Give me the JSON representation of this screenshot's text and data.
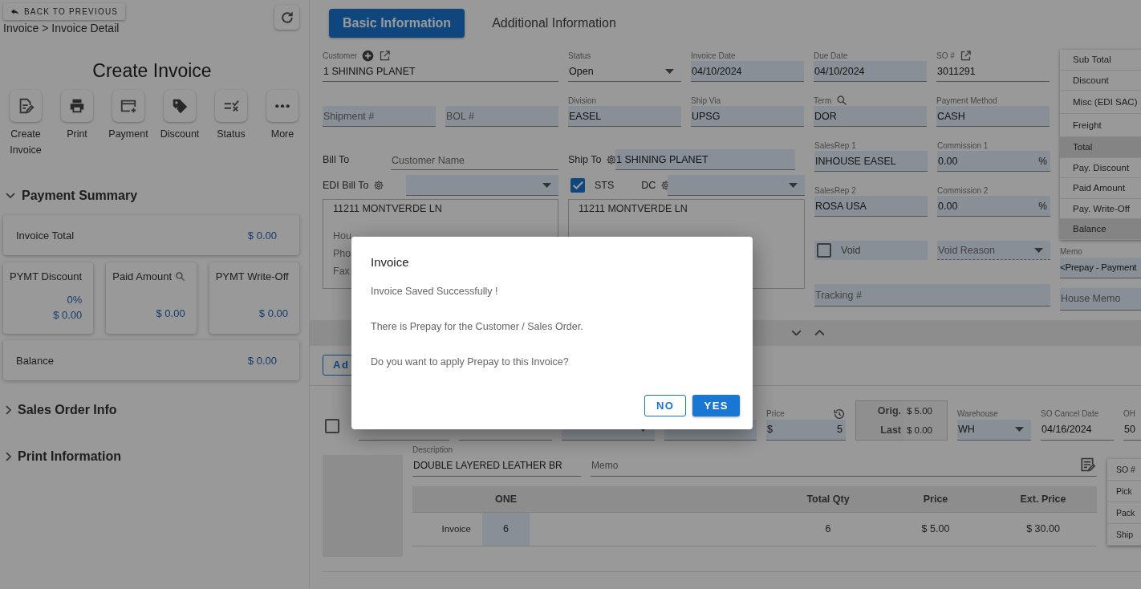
{
  "sidebar": {
    "back_button": "BACK TO PREVIOUS",
    "breadcrumb": "Invoice > Invoice Detail",
    "title": "Create Invoice",
    "actions": [
      {
        "label": "Create Invoice"
      },
      {
        "label": "Print"
      },
      {
        "label": "Payment"
      },
      {
        "label": "Discount"
      },
      {
        "label": "Status"
      },
      {
        "label": "More"
      }
    ],
    "payment_summary": {
      "title": "Payment Summary",
      "expanded": true,
      "invoice_total": {
        "label": "Invoice Total",
        "value": "$ 0.00"
      },
      "cards": [
        {
          "label": "PYMT Discount",
          "percent": "0%",
          "value": "$ 0.00"
        },
        {
          "label": "Paid Amount",
          "value": "$ 0.00"
        },
        {
          "label": "PYMT Write-Off",
          "value": "$ 0.00"
        }
      ],
      "balance": {
        "label": "Balance",
        "value": "$ 0.00"
      }
    },
    "sections": [
      {
        "title": "Sales Order Info",
        "expanded": false
      },
      {
        "title": "Print Information",
        "expanded": false
      }
    ]
  },
  "tabs": [
    {
      "label": "Basic Information",
      "selected": true
    },
    {
      "label": "Additional Information",
      "selected": false
    }
  ],
  "form": {
    "row1": [
      {
        "label": "Customer",
        "value": "1 SHINING PLANET",
        "kind": "text"
      },
      {
        "label": "Status",
        "value": "Open",
        "kind": "select"
      },
      {
        "label": "Invoice Date",
        "value": "04/10/2024",
        "kind": "text"
      },
      {
        "label": "Due Date",
        "value": "04/10/2024",
        "kind": "text"
      },
      {
        "label": "SO #",
        "value": "3011291",
        "kind": "text"
      }
    ],
    "row2": [
      {
        "placeholder": "Shipment #",
        "kind": "text"
      },
      {
        "placeholder": "BOL #",
        "kind": "text"
      },
      {
        "label": "Division",
        "value": "EASEL",
        "kind": "text"
      },
      {
        "label": "Ship Via",
        "value": "UPSG",
        "kind": "text"
      },
      {
        "label": "Term",
        "value": "DOR",
        "kind": "text"
      },
      {
        "label": "Payment Method",
        "value": "CASH",
        "kind": "text"
      }
    ],
    "bill_to": {
      "label": "Bill To",
      "name": {
        "placeholder": "Customer Name",
        "kind": "text"
      },
      "edi_label": "EDI Bill To",
      "edi": {
        "kind": "select"
      },
      "address": [
        "11211 MONTVERDE LN",
        "Hou",
        "Pho",
        "Fax"
      ]
    },
    "ship_to": {
      "label": "Ship To",
      "field": {
        "value": "1 SHINING PLANET",
        "kind": "text"
      },
      "sts": {
        "label": "STS",
        "checked": true
      },
      "dc_label": "DC",
      "dc": {
        "kind": "select"
      },
      "address": [
        "11211 MONTVERDE LN"
      ]
    },
    "reps": [
      {
        "label": "SalesRep 1",
        "value": "INHOUSE EASEL",
        "kind": "text"
      },
      {
        "label": "Commission 1",
        "value": "0.00",
        "suffix": "%",
        "kind": "text"
      },
      {
        "label": "SalesRep 2",
        "value": "ROSA USA",
        "kind": "text"
      },
      {
        "label": "Commission 2",
        "value": "0.00",
        "suffix": "%",
        "kind": "text"
      }
    ],
    "void": {
      "label": "Void",
      "checked": false
    },
    "void_reason": {
      "placeholder": "Void Reason",
      "kind": "select",
      "disabled": true
    },
    "tracking": {
      "placeholder": "Tracking #",
      "kind": "text"
    },
    "summary_menu": [
      {
        "label": "Sub Total",
        "highlighted": false
      },
      {
        "label": "Discount",
        "highlighted": false
      },
      {
        "label": "Misc (EDI SAC)",
        "highlighted": false
      },
      {
        "label": "Freight",
        "highlighted": false
      },
      {
        "label": "Total",
        "highlighted": true
      },
      {
        "label": "Pay. Discount",
        "highlighted": false
      },
      {
        "label": "Paid Amount",
        "highlighted": false
      },
      {
        "label": "Pay. Write-Off",
        "highlighted": false
      },
      {
        "label": "Balance",
        "highlighted": true
      }
    ],
    "memo": {
      "label": "Memo",
      "value": "<Prepay - Payment",
      "kind": "text"
    },
    "house_memo": {
      "placeholder": "House Memo",
      "kind": "text"
    }
  },
  "add_button": "Ad",
  "line_item": {
    "checked": false,
    "fields": [
      {
        "kind": "text"
      },
      {
        "kind": "text"
      },
      {
        "kind": "select"
      },
      {
        "kind": "text"
      },
      {
        "label": "Price",
        "prefix": "$",
        "value": "5",
        "kind": "price"
      },
      {
        "kind": "compare",
        "rows": [
          {
            "label": "Orig.",
            "value": "$ 5.00"
          },
          {
            "label": "Last",
            "value": "$ 0.00"
          }
        ]
      },
      {
        "label": "Warehouse",
        "value": "WH",
        "kind": "select"
      },
      {
        "label": "SO Cancel Date",
        "value": "04/16/2024",
        "kind": "text"
      },
      {
        "label": "OH",
        "value": "50",
        "kind": "text"
      }
    ],
    "description": {
      "label": "Description",
      "value": "DOUBLE LAYERED LEATHER BR",
      "kind": "text"
    },
    "memo": {
      "placeholder": "Memo",
      "kind": "text"
    },
    "size_table": {
      "columns": [
        "ONE",
        "Total Qty",
        "Price",
        "Ext. Price"
      ],
      "rows": [
        {
          "label": "Invoice",
          "cells": [
            "6",
            "6",
            "$ 5.00",
            "$ 30.00"
          ]
        }
      ]
    }
  },
  "side_menu": [
    "SO #",
    "Pick",
    "Pack",
    "Ship"
  ],
  "dialog": {
    "title": "Invoice",
    "messages": [
      "Invoice Saved Successfully !",
      "There is Prepay for the Customer / Sales Order.",
      "Do you want to apply Prepay to this Invoice?"
    ],
    "buttons": [
      {
        "label": "NO",
        "kind": "secondary"
      },
      {
        "label": "YES",
        "kind": "primary"
      }
    ]
  }
}
